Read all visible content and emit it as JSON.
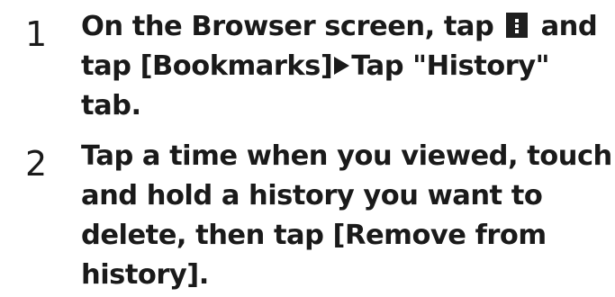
{
  "steps": [
    {
      "number": "1",
      "line1_before_icon": "On the Browser screen, tap",
      "line1_after_icon": "and",
      "line2_before_arrow": "tap [Bookmarks]",
      "line2_after_arrow": "Tap \"History\"",
      "line3": "tab.",
      "icons": [
        "menu-icon",
        "arrow-right-icon"
      ]
    },
    {
      "number": "2",
      "lines": [
        "Tap a time when you viewed, touch",
        "and hold a history you want to",
        "delete, then tap [Remove from",
        "history]."
      ]
    }
  ]
}
